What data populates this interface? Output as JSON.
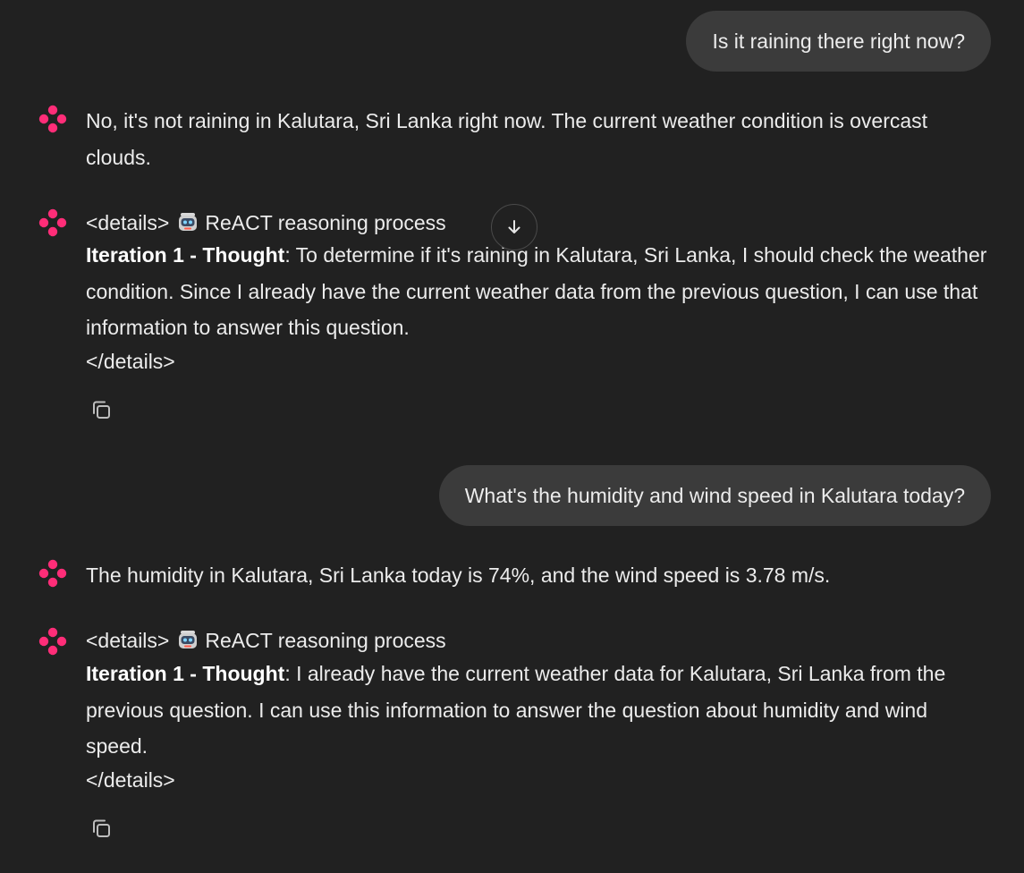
{
  "conversation": {
    "user_message_1": "Is it raining there right now?",
    "assistant_reply_1": "No, it's not raining in Kalutara, Sri Lanka right now. The current weather condition is overcast clouds.",
    "details_1": {
      "open_tag": "<details>",
      "summary": "ReACT reasoning process",
      "thought_label": "Iteration 1 - Thought",
      "thought_text": ": To determine if it's raining in Kalutara, Sri Lanka, I should check the weather condition. Since I already have the current weather data from the previous question, I can use that information to answer this question.",
      "close_tag": "</details>"
    },
    "user_message_2": "What's the humidity and wind speed in Kalutara today?",
    "assistant_reply_2": "The humidity in Kalutara, Sri Lanka today is 74%, and the wind speed is 3.78 m/s.",
    "details_2": {
      "open_tag": "<details>",
      "summary": "ReACT reasoning process",
      "thought_label": "Iteration 1 - Thought",
      "thought_text": ": I already have the current weather data for Kalutara, Sri Lanka from the previous question. I can use this information to answer the question about humidity and wind speed.",
      "close_tag": "</details>"
    }
  },
  "icons": {
    "assistant_avatar": "sparkle-flower-icon",
    "robot_emoji": "robot-icon",
    "copy": "copy-icon",
    "scroll_down": "arrow-down-icon"
  },
  "colors": {
    "background": "#212121",
    "user_bubble": "#3b3b3b",
    "text": "#ececec",
    "accent": "#ff2d78"
  }
}
